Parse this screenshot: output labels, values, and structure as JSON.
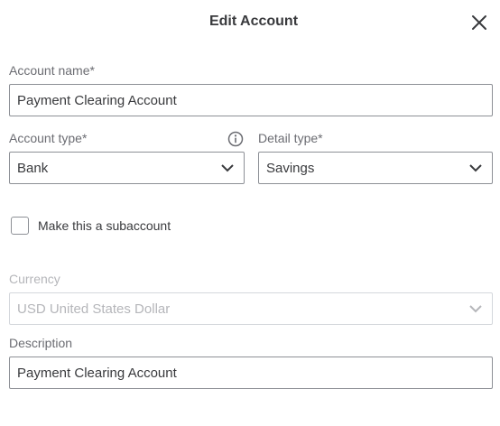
{
  "dialog": {
    "title": "Edit Account",
    "close_icon": "close-icon"
  },
  "form": {
    "account_name": {
      "label": "Account name*",
      "value": "Payment Clearing Account"
    },
    "account_type": {
      "label": "Account type*",
      "value": "Bank",
      "info_icon": "info-icon"
    },
    "detail_type": {
      "label": "Detail type*",
      "value": "Savings"
    },
    "subaccount": {
      "label": "Make this a subaccount",
      "checked": false
    },
    "currency": {
      "label": "Currency",
      "value": "USD United States Dollar",
      "disabled": true
    },
    "description": {
      "label": "Description",
      "value": "Payment Clearing Account"
    }
  },
  "colors": {
    "text": "#393a3d",
    "label": "#6b6c72",
    "border": "#8d9096",
    "disabled_text": "#b5b6ba",
    "disabled_border": "#d4d7dc"
  }
}
